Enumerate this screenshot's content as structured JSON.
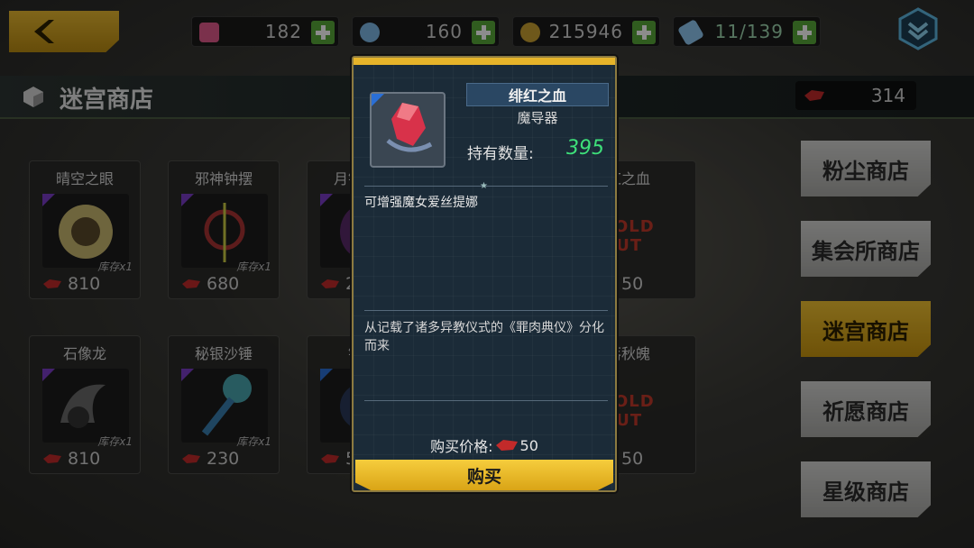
{
  "topbar": {
    "resources": [
      {
        "value": "182",
        "icon": "stamina-icon",
        "color": "#e05a8a"
      },
      {
        "value": "160",
        "icon": "cloud-gem-icon",
        "color": "#7fb8e6"
      },
      {
        "value": "215946",
        "icon": "gold-coin-icon",
        "color": "#c9a032"
      },
      {
        "value": "11/139",
        "icon": "ticket-icon",
        "color": "#8fc6f0"
      }
    ]
  },
  "shop": {
    "title": "迷宫商店",
    "currency_value": "314"
  },
  "grid": {
    "items": [
      {
        "name": "晴空之眼",
        "stock": "库存x1",
        "price": "810"
      },
      {
        "name": "邪神钟摆",
        "stock": "库存x1",
        "price": "680"
      },
      {
        "name": "月银刹那",
        "stock": "",
        "price": "230"
      },
      {
        "name": "石像龙",
        "stock": "库存x1",
        "price": "810"
      },
      {
        "name": "秘银沙锤",
        "stock": "库存x1",
        "price": "230"
      },
      {
        "name": "银狐",
        "stock": "",
        "price": "50"
      }
    ],
    "behind_items": [
      {
        "name": "红之血",
        "status": "SOLD OUT",
        "price": "50"
      },
      {
        "name": "落秋魄",
        "status": "SOLD OUT",
        "price": "50"
      }
    ]
  },
  "tabs": [
    {
      "label": "粉尘商店",
      "active": false
    },
    {
      "label": "集会所商店",
      "active": false
    },
    {
      "label": "迷宫商店",
      "active": true
    },
    {
      "label": "祈愿商店",
      "active": false
    },
    {
      "label": "星级商店",
      "active": false
    }
  ],
  "modal": {
    "item_name": "绯红之血",
    "item_type": "魔导器",
    "owned_label": "持有数量:",
    "owned_value": "395",
    "effect": "可增强魔女爱丝提娜",
    "description": "从记载了诸多异教仪式的《罪肉典仪》分化而来",
    "price_label": "购买价格:",
    "price_value": "50",
    "buy_label": "购买"
  },
  "colors": {
    "accent_gold": "#e6b42a",
    "plus_green": "#58a83a",
    "owned_green": "#3ee07a",
    "rarity_purple": "#7a3cc6",
    "rarity_blue": "#2a6fd6"
  }
}
